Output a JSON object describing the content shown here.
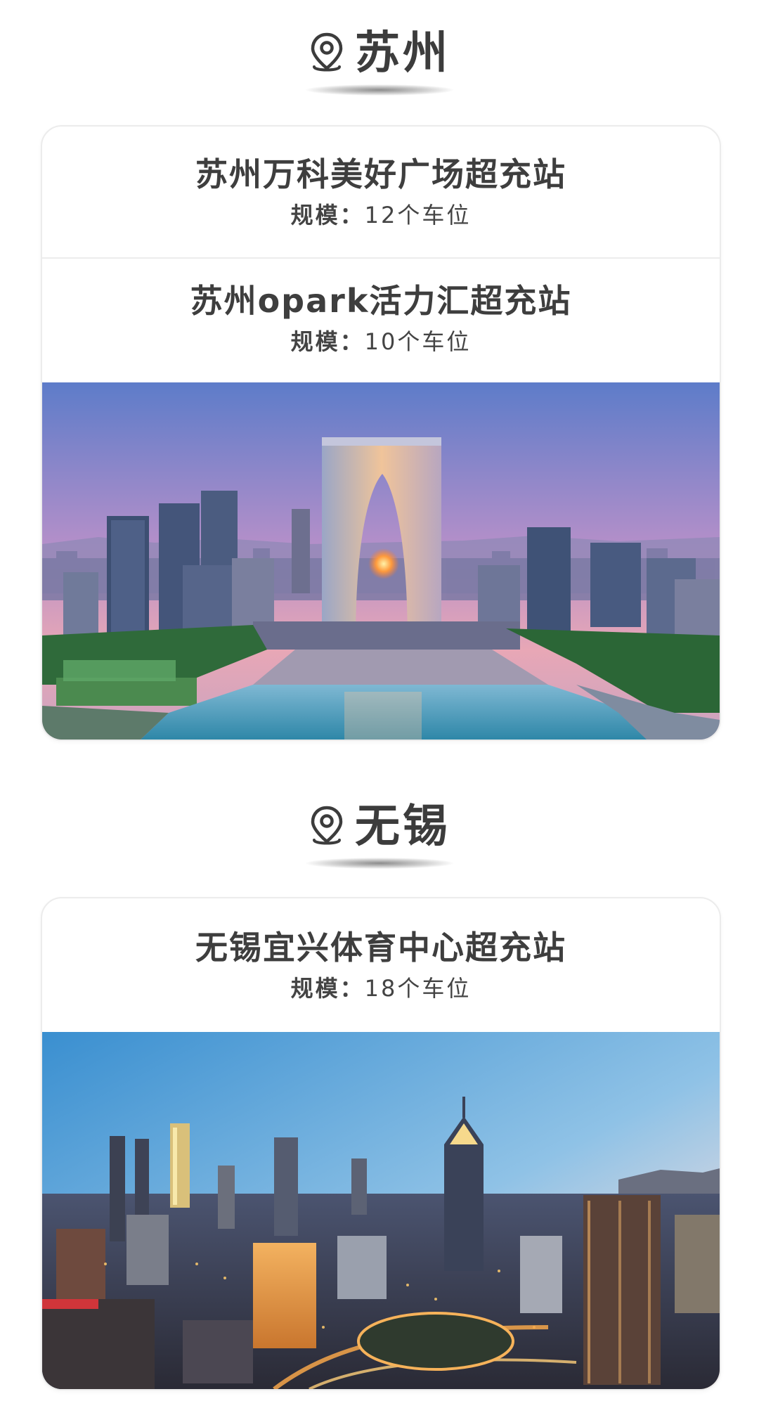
{
  "sections": [
    {
      "city": "苏州",
      "stations": [
        {
          "name": "苏州万科美好广场超充站",
          "scale_label": "规模：",
          "scale_value": "12个车位"
        },
        {
          "name": "苏州opark活力汇超充站",
          "scale_label": "规模：",
          "scale_value": "10个车位"
        }
      ],
      "photo_icon": "suzhou-gate-of-orient-skyline-photo"
    },
    {
      "city": "无锡",
      "stations": [
        {
          "name": "无锡宜兴体育中心超充站",
          "scale_label": "规模：",
          "scale_value": "18个车位"
        }
      ],
      "photo_icon": "wuxi-night-skyline-photo"
    }
  ],
  "colors": {
    "heading_text": "#3c3c3c",
    "card_border": "#ececec",
    "body_text": "#3e3e3e"
  }
}
